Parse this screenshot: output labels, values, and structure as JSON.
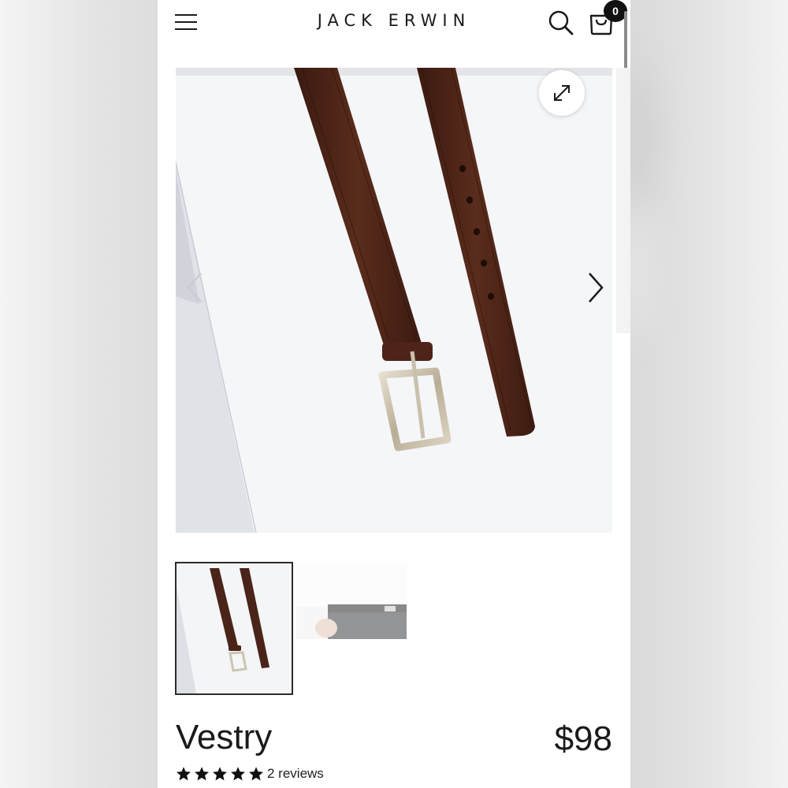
{
  "store": {
    "brand": "JACK ERWIN",
    "cart_count": "0"
  },
  "icons": {
    "menu": "hamburger-menu-icon",
    "search": "search-icon",
    "cart": "shopping-bag-icon",
    "expand": "expand-icon",
    "prev": "chevron-left-icon",
    "next": "chevron-right-icon",
    "star": "star-icon"
  },
  "gallery": {
    "main_image_alt": "Brown leather belt with brushed silver buckle",
    "thumbnails": [
      {
        "alt": "Belt thumbnail",
        "active": true
      },
      {
        "alt": "Belt worn thumbnail",
        "active": false
      }
    ]
  },
  "product": {
    "title": "Vestry",
    "price": "$98",
    "rating": 5,
    "reviews_label": "2 reviews"
  },
  "colors": {
    "text": "#1a1a1a",
    "leather": "#4a2418",
    "buckle": "#cfc6b4",
    "background": "#ffffff"
  }
}
